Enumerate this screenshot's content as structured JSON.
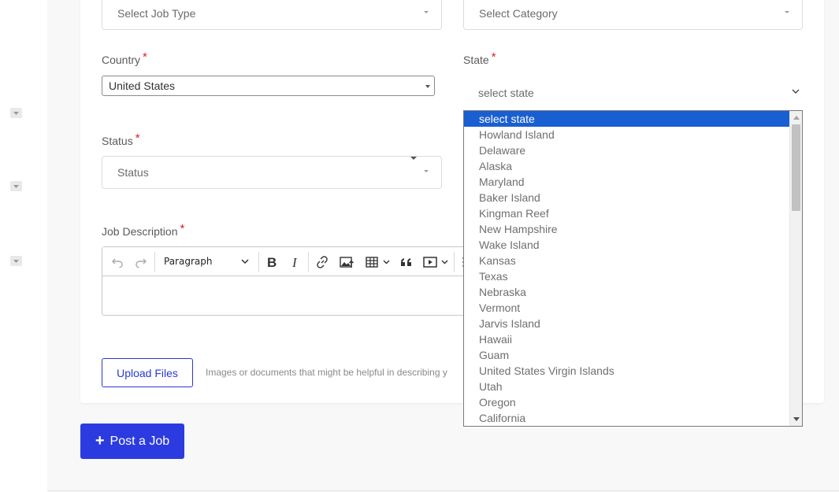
{
  "form": {
    "job_type": {
      "placeholder": "Select Job Type"
    },
    "category": {
      "placeholder": "Select Category"
    },
    "country": {
      "label": "Country",
      "required_mark": "*",
      "value": "United States"
    },
    "state": {
      "label": "State",
      "required_mark": "*",
      "value": "select state"
    },
    "status": {
      "label": "Status",
      "required_mark": "*",
      "placeholder": "Status"
    },
    "job_description": {
      "label": "Job Description",
      "required_mark": "*",
      "toolbar": {
        "undo_icon": "undo-icon",
        "redo_icon": "redo-icon",
        "heading_value": "Paragraph",
        "bold_icon": "bold-icon",
        "italic_icon": "italic-icon",
        "link_icon": "link-icon",
        "image_upload_icon": "image-upload-icon",
        "table_icon": "table-icon",
        "blockquote_icon": "blockquote-icon",
        "media_icon": "media-embed-icon"
      }
    },
    "upload": {
      "button_label": "Upload Files",
      "hint": "Images or documents that might be helpful in describing y"
    }
  },
  "post_button": {
    "label": "Post a Job",
    "icon": "+"
  },
  "state_dropdown": {
    "options": [
      "select state",
      "Howland Island",
      "Delaware",
      "Alaska",
      "Maryland",
      "Baker Island",
      "Kingman Reef",
      "New Hampshire",
      "Wake Island",
      "Kansas",
      "Texas",
      "Nebraska",
      "Vermont",
      "Jarvis Island",
      "Hawaii",
      "Guam",
      "United States Virgin Islands",
      "Utah",
      "Oregon",
      "California"
    ],
    "selected_index": 0
  },
  "colors": {
    "accent": "#2b3be0",
    "selected_option": "#1a5fd1",
    "required": "#e11d1d"
  }
}
